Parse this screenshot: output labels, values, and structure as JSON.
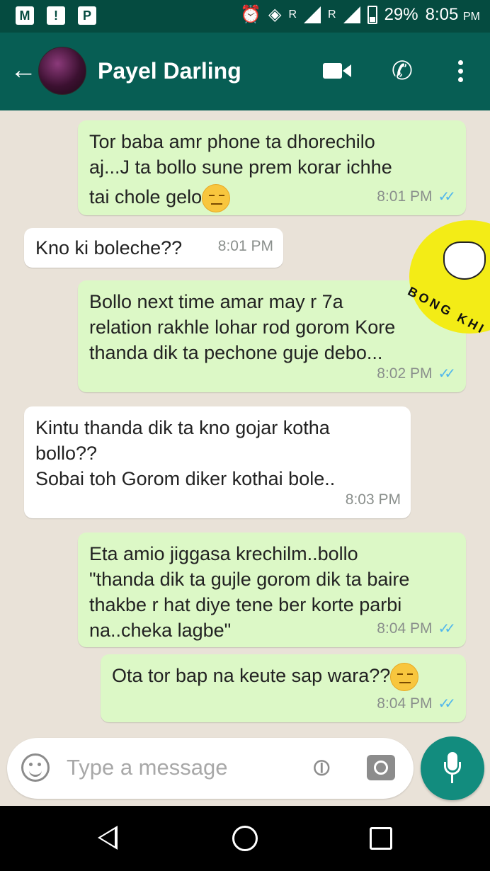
{
  "status_bar": {
    "left_icons": [
      "gmail-icon",
      "notification-icon",
      "paytm-icon"
    ],
    "sig_label_1": "R",
    "sig_label_2": "R",
    "battery": "29%",
    "time": "8:05",
    "ampm": "PM"
  },
  "header": {
    "contact_name": "Payel Darling",
    "icons": [
      "back-arrow-icon",
      "video-call-icon",
      "voice-call-icon",
      "more-options-icon"
    ]
  },
  "messages": [
    {
      "direction": "out",
      "lines": [
        "Tor baba amr phone ta dhorechilo",
        "aj...J ta bollo sune prem korar ichhe",
        "tai chole gelo"
      ],
      "emoji": "expressionless-face",
      "time": "8:01 PM",
      "read": true
    },
    {
      "direction": "in",
      "lines": [
        "Kno ki boleche??"
      ],
      "time": "8:01 PM"
    },
    {
      "direction": "out",
      "lines": [
        "Bollo next time amar may r 7a",
        "relation rakhle lohar rod gorom Kore",
        "thanda dik ta pechone guje debo..."
      ],
      "time": "8:02 PM",
      "read": true
    },
    {
      "direction": "in",
      "lines": [
        "Kintu thanda dik ta kno gojar kotha",
        "bollo??",
        "Sobai toh Gorom diker kothai bole.."
      ],
      "time": "8:03 PM"
    },
    {
      "direction": "out",
      "lines": [
        "Eta amio jiggasa krechilm..bollo",
        "\"thanda dik ta gujle gorom dik ta baire",
        "thakbe r hat diye tene ber korte parbi",
        "na..cheka lagbe\""
      ],
      "time": "8:04 PM",
      "read": true
    },
    {
      "direction": "out",
      "lines": [
        "Ota tor bap na keute sap wara??"
      ],
      "emoji": "expressionless-face",
      "time": "8:04 PM",
      "read": true
    }
  ],
  "watermark": {
    "text": "BONG KHI"
  },
  "input": {
    "placeholder": "Type a message"
  },
  "colors": {
    "header": "#075e54",
    "status_bar": "#054b40",
    "outgoing": "#dcf8c6",
    "incoming": "#ffffff",
    "read_ticks": "#4fb6ec",
    "mic_button": "#128c7e",
    "watermark": "#f3ec16"
  }
}
